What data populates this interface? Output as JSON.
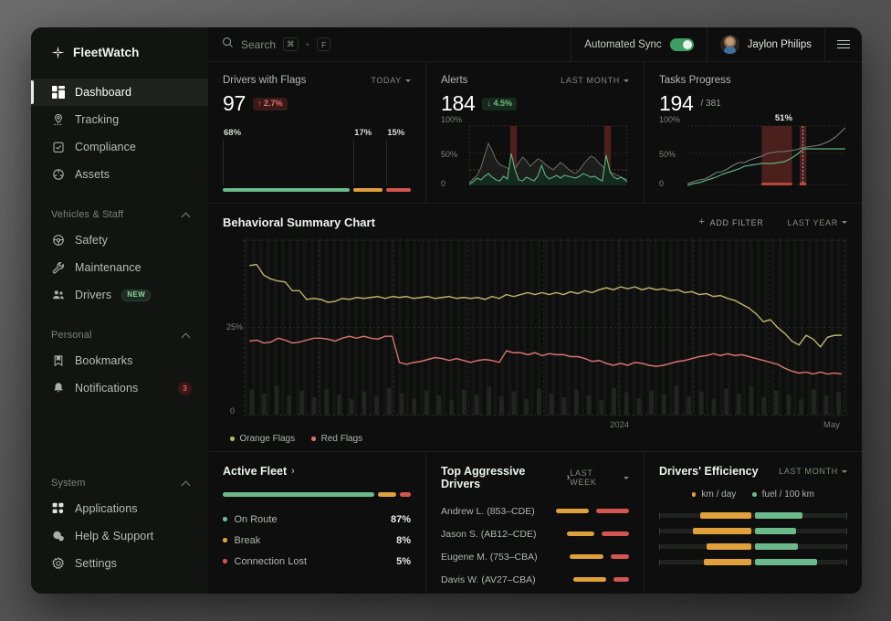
{
  "brand": {
    "name": "FleetWatch",
    "icon": "sparkle-icon"
  },
  "sidebar": {
    "nav": [
      {
        "label": "Dashboard",
        "icon": "dashboard-icon",
        "active": true
      },
      {
        "label": "Tracking",
        "icon": "location-pin-icon",
        "active": false
      },
      {
        "label": "Compliance",
        "icon": "clipboard-check-icon",
        "active": false
      },
      {
        "label": "Assets",
        "icon": "package-icon",
        "active": false
      }
    ],
    "groups": [
      {
        "title": "Vehicles & Staff",
        "items": [
          {
            "label": "Safety",
            "icon": "steering-wheel-icon"
          },
          {
            "label": "Maintenance",
            "icon": "wrench-icon"
          },
          {
            "label": "Drivers",
            "icon": "users-icon",
            "badge": "NEW"
          }
        ]
      },
      {
        "title": "Personal",
        "items": [
          {
            "label": "Bookmarks",
            "icon": "bookmark-icon"
          },
          {
            "label": "Notifications",
            "icon": "bell-icon",
            "count": "3"
          }
        ]
      },
      {
        "title": "System",
        "items": [
          {
            "label": "Applications",
            "icon": "grid-apps-icon"
          },
          {
            "label": "Help & Support",
            "icon": "chat-bubbles-icon"
          },
          {
            "label": "Settings",
            "icon": "gear-icon"
          }
        ]
      }
    ]
  },
  "topbar": {
    "search": {
      "placeholder": "Search",
      "icon": "search-icon",
      "key1": "⌘",
      "plus": "+",
      "key2": "F"
    },
    "sync": {
      "label": "Automated Sync",
      "enabled": true
    },
    "user": {
      "name": "Jaylon Philips"
    },
    "menu_icon": "hamburger-menu-icon"
  },
  "kpis": [
    {
      "title": "Drivers with Flags",
      "period": "TODAY",
      "value": "97",
      "delta": {
        "text": "↑ 2.7%",
        "direction": "up"
      },
      "segments": [
        {
          "pct": "68%",
          "value": 68,
          "color": "#6cb98c"
        },
        {
          "pct": "17%",
          "value": 17,
          "color": "#e0a13c"
        },
        {
          "pct": "15%",
          "value": 15,
          "color": "#d2564f"
        }
      ]
    },
    {
      "title": "Alerts",
      "period": "LAST MONTH",
      "value": "184",
      "delta": {
        "text": "↓ 4.5%",
        "direction": "down"
      },
      "axis": [
        "100%",
        "50%",
        "0"
      ]
    },
    {
      "title": "Tasks Progress",
      "period": "",
      "value": "194",
      "sub": "/ 381",
      "axis": [
        "100%",
        "50%",
        "0"
      ],
      "peak": "51%"
    }
  ],
  "behavioral": {
    "title": "Behavioral Summary Chart",
    "add_filter": "ADD FILTER",
    "period": "LAST YEAR",
    "legend": [
      {
        "label": "Orange Flags",
        "color": "#bcb06a"
      },
      {
        "label": "Red Flags",
        "color": "#d9726e"
      }
    ],
    "y_ticks": [
      "25%",
      "0"
    ],
    "x_ticks": [
      "2024",
      "May"
    ]
  },
  "active_fleet": {
    "title": "Active Fleet",
    "rows": [
      {
        "label": "On Route",
        "pct": "87%",
        "value": 87,
        "color": "#6cb98c"
      },
      {
        "label": "Break",
        "pct": "8%",
        "value": 8,
        "color": "#e0a13c"
      },
      {
        "label": "Connection Lost",
        "pct": "5%",
        "value": 5,
        "color": "#d2564f"
      }
    ]
  },
  "aggressive_drivers": {
    "title": "Top Aggressive Drivers",
    "period": "LAST WEEK",
    "rows": [
      {
        "name": "Andrew L. (853–CDE)",
        "orange": 36,
        "red": 44
      },
      {
        "name": "Jason S. (AB12–CDE)",
        "orange": 45,
        "red": 37
      },
      {
        "name": "Eugene M. (753–CBA)",
        "orange": 53,
        "red": 25
      },
      {
        "name": "Davis W. (AV27–CBA)",
        "orange": 50,
        "red": 22
      }
    ]
  },
  "efficiency": {
    "title": "Drivers' Efficiency",
    "period": "LAST MONTH",
    "legend": [
      {
        "label": "km / day",
        "color": "#e0a13c"
      },
      {
        "label": "fuel / 100 km",
        "color": "#6cb98c"
      }
    ],
    "rows": [
      {
        "orange_start": 22,
        "orange_end": 49,
        "green_start": 51,
        "green_end": 76
      },
      {
        "orange_start": 18,
        "orange_end": 49,
        "green_start": 51,
        "green_end": 73
      },
      {
        "orange_start": 25,
        "orange_end": 49,
        "green_start": 51,
        "green_end": 74
      },
      {
        "orange_start": 24,
        "orange_end": 49,
        "green_start": 51,
        "green_end": 84
      }
    ]
  },
  "chart_data": {
    "type": "line",
    "title": "Behavioral Summary Chart",
    "xlabel": "",
    "ylabel": "",
    "ylim": [
      0,
      50
    ],
    "y_ticks": [
      0,
      25
    ],
    "x_ticks": [
      "2024",
      "May"
    ],
    "grid": true,
    "series": [
      {
        "name": "Orange Flags",
        "color": "#bcb06a",
        "values": [
          41,
          40,
          37,
          36,
          35,
          34,
          34,
          33,
          31,
          31,
          31,
          30,
          31,
          30,
          30,
          31,
          30,
          30,
          31,
          31,
          31,
          30,
          30,
          31,
          30,
          31,
          30,
          31,
          31,
          30,
          31,
          30,
          31,
          30,
          30,
          29,
          28,
          28,
          27,
          27,
          26,
          26,
          25,
          25,
          25,
          24,
          24,
          23,
          23,
          24,
          24,
          24,
          25,
          26,
          26,
          26,
          27,
          27,
          27,
          26,
          26,
          27,
          27,
          28,
          29,
          28,
          28,
          28,
          27,
          28,
          27,
          27,
          27,
          26,
          26,
          25,
          24,
          22,
          22,
          20,
          18,
          16,
          17,
          17
        ]
      },
      {
        "name": "Red Flags",
        "color": "#d9726e",
        "values": [
          23,
          23,
          22,
          22,
          24,
          23,
          22,
          22,
          23,
          24,
          24,
          24,
          23,
          24,
          25,
          24,
          25,
          24,
          24,
          25,
          25,
          18,
          17,
          18,
          18,
          19,
          20,
          20,
          19,
          20,
          19,
          18,
          19,
          19,
          19,
          18,
          23,
          22,
          22,
          21,
          22,
          21,
          22,
          22,
          22,
          21,
          21,
          20,
          19,
          19,
          18,
          17,
          16,
          17,
          17,
          16,
          17,
          17,
          16,
          16,
          16,
          17,
          18,
          18,
          19,
          19,
          20,
          21,
          21,
          20,
          21,
          21,
          22,
          21,
          21,
          20,
          19,
          18,
          17,
          15,
          14,
          14,
          14,
          14
        ]
      },
      {
        "name": "Volume Bars",
        "color": "#1f221f",
        "values": [
          5,
          7,
          4,
          6,
          5,
          4,
          6,
          5,
          4,
          5,
          6,
          4,
          5,
          6,
          5,
          4,
          5,
          6,
          4,
          5,
          4,
          6,
          5,
          4,
          5,
          6,
          5,
          4,
          6,
          5,
          4,
          5,
          6,
          4,
          5,
          6,
          5,
          4,
          5,
          6,
          5,
          4,
          6,
          5,
          4,
          5,
          6,
          5,
          4,
          5,
          6,
          4,
          5,
          6,
          5,
          4,
          5,
          6,
          5,
          4,
          6,
          5,
          4,
          5,
          6,
          5,
          4,
          5,
          6,
          5,
          4,
          6,
          5,
          4,
          5,
          6,
          5,
          4,
          5,
          6,
          5,
          4,
          5,
          6
        ]
      }
    ]
  },
  "alerts_chart": {
    "type": "area",
    "ylim": [
      0,
      100
    ],
    "bands": [
      {
        "x": 30,
        "w": 5
      },
      {
        "x": 82,
        "w": 5
      }
    ],
    "series": [
      {
        "name": "gray",
        "color": "#6b6f6b",
        "values": [
          8,
          12,
          18,
          30,
          48,
          62,
          52,
          40,
          33,
          30,
          28,
          26,
          27,
          34,
          41,
          36,
          30,
          34,
          38,
          35,
          30,
          27,
          24,
          28,
          33,
          30,
          26,
          22,
          20,
          25,
          33,
          40,
          45,
          42,
          36,
          30,
          26,
          23,
          20,
          18,
          16,
          14,
          13,
          12,
          12,
          11,
          10,
          10
        ]
      },
      {
        "name": "green",
        "color": "#5fae7e",
        "values": [
          3,
          6,
          12,
          9,
          14,
          18,
          13,
          10,
          8,
          14,
          44,
          22,
          10,
          8,
          13,
          11,
          9,
          14,
          11,
          24,
          14,
          10,
          12,
          14,
          11,
          14,
          13,
          12,
          11,
          13,
          16,
          14,
          12,
          14,
          11,
          10,
          12,
          16,
          38,
          22,
          13,
          11,
          10,
          12,
          14,
          11,
          9,
          7
        ]
      }
    ]
  },
  "tasks_chart": {
    "type": "line",
    "ylim": [
      0,
      100
    ],
    "peak_label": "51%",
    "band": {
      "x": 42,
      "w": 17
    },
    "marker_x": 62,
    "series": [
      {
        "name": "gray",
        "color": "#7a7e7a",
        "values": [
          3,
          5,
          8,
          10,
          12,
          16,
          18,
          22,
          26,
          30,
          30,
          33,
          35,
          38,
          42,
          44,
          45,
          45,
          46,
          47,
          50,
          52,
          53,
          54,
          55,
          57,
          58,
          60,
          61,
          63,
          66,
          70,
          74,
          78,
          86,
          95
        ]
      },
      {
        "name": "green",
        "color": "#5fae7e",
        "values": [
          1,
          3,
          5,
          8,
          9,
          12,
          15,
          17,
          20,
          22,
          25,
          26,
          27,
          28,
          28,
          28,
          29,
          30,
          34,
          40,
          48,
          51,
          51,
          51,
          51,
          51,
          51,
          51,
          51,
          51,
          51,
          51,
          51,
          51,
          51,
          51
        ]
      }
    ]
  }
}
